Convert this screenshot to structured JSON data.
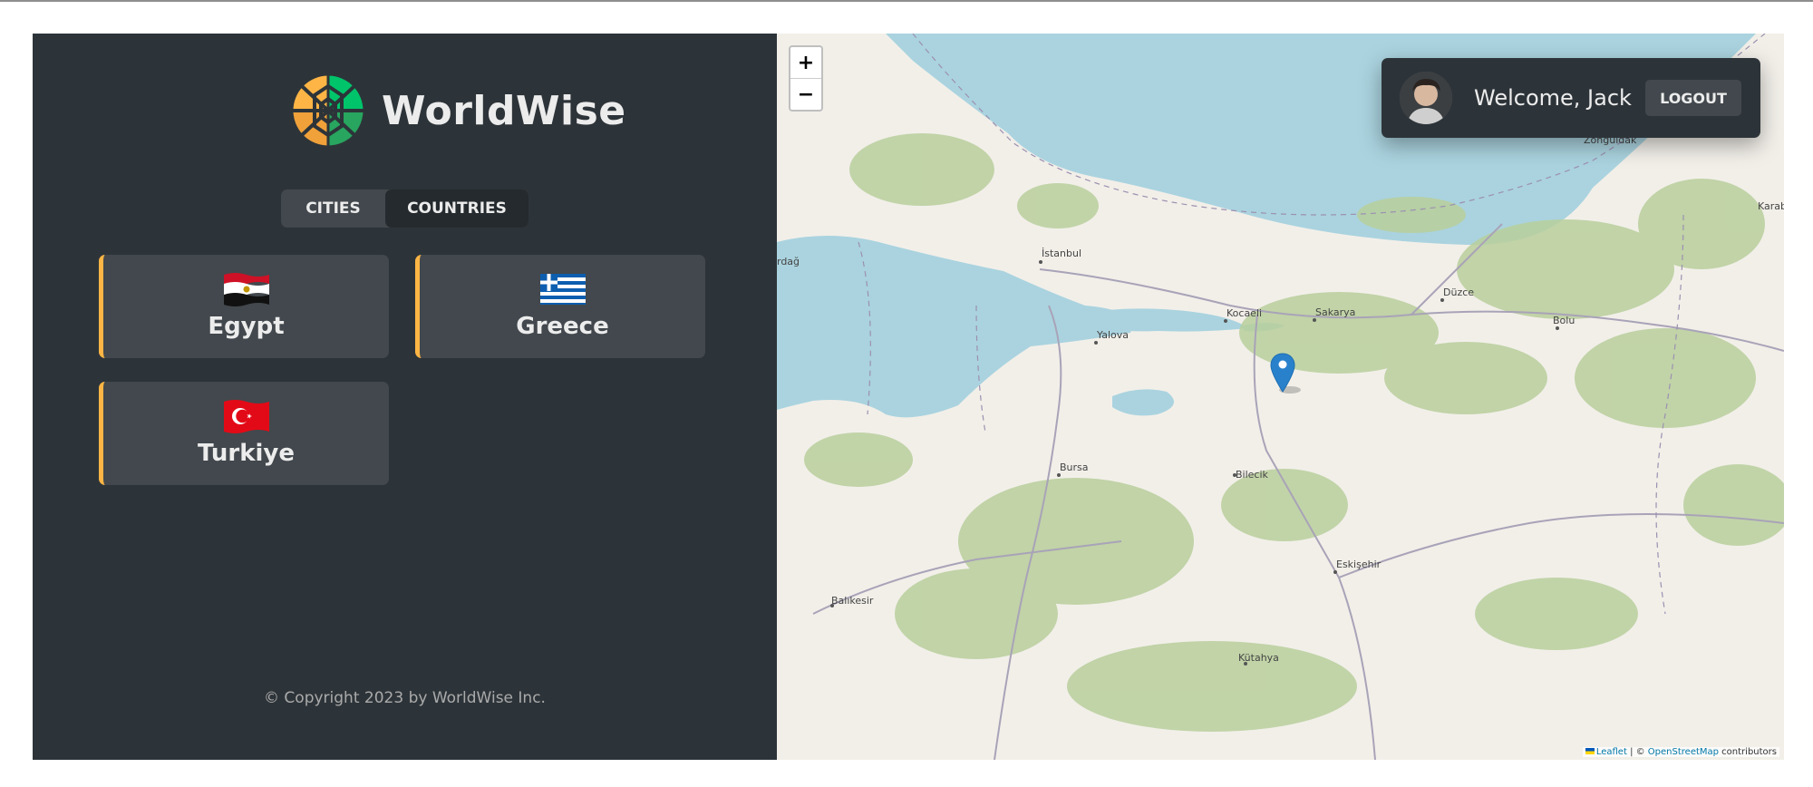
{
  "app": {
    "name": "WorldWise",
    "tabs": {
      "cities": "CITIES",
      "countries": "COUNTRIES"
    },
    "active_tab": "countries",
    "countries": [
      {
        "name": "Egypt",
        "flag": "egypt-flag-icon"
      },
      {
        "name": "Greece",
        "flag": "greece-flag-icon"
      },
      {
        "name": "Turkiye",
        "flag": "turkiye-flag-icon"
      }
    ],
    "copyright": "© Copyright 2023 by WorldWise Inc."
  },
  "user": {
    "welcome": "Welcome, Jack",
    "logout": "LOGOUT"
  },
  "map": {
    "zoom_in": "+",
    "zoom_out": "−",
    "cities": [
      "İstanbul",
      "Kocaeli",
      "Sakarya",
      "Düzce",
      "Bolu",
      "Yalova",
      "Bursa",
      "Bilecik",
      "Eskişehir",
      "Balıkesir",
      "Kütahya",
      "Zonguldak",
      "Karabü",
      "rdağ"
    ],
    "attribution": {
      "leaflet": "Leaflet",
      "sep": " | © ",
      "osm": "OpenStreetMap",
      "rest": " contributors"
    }
  },
  "colors": {
    "accent": "#ffb545",
    "sidebar_bg": "#2d3439",
    "card_bg": "#42484d",
    "water": "#aad3df"
  }
}
